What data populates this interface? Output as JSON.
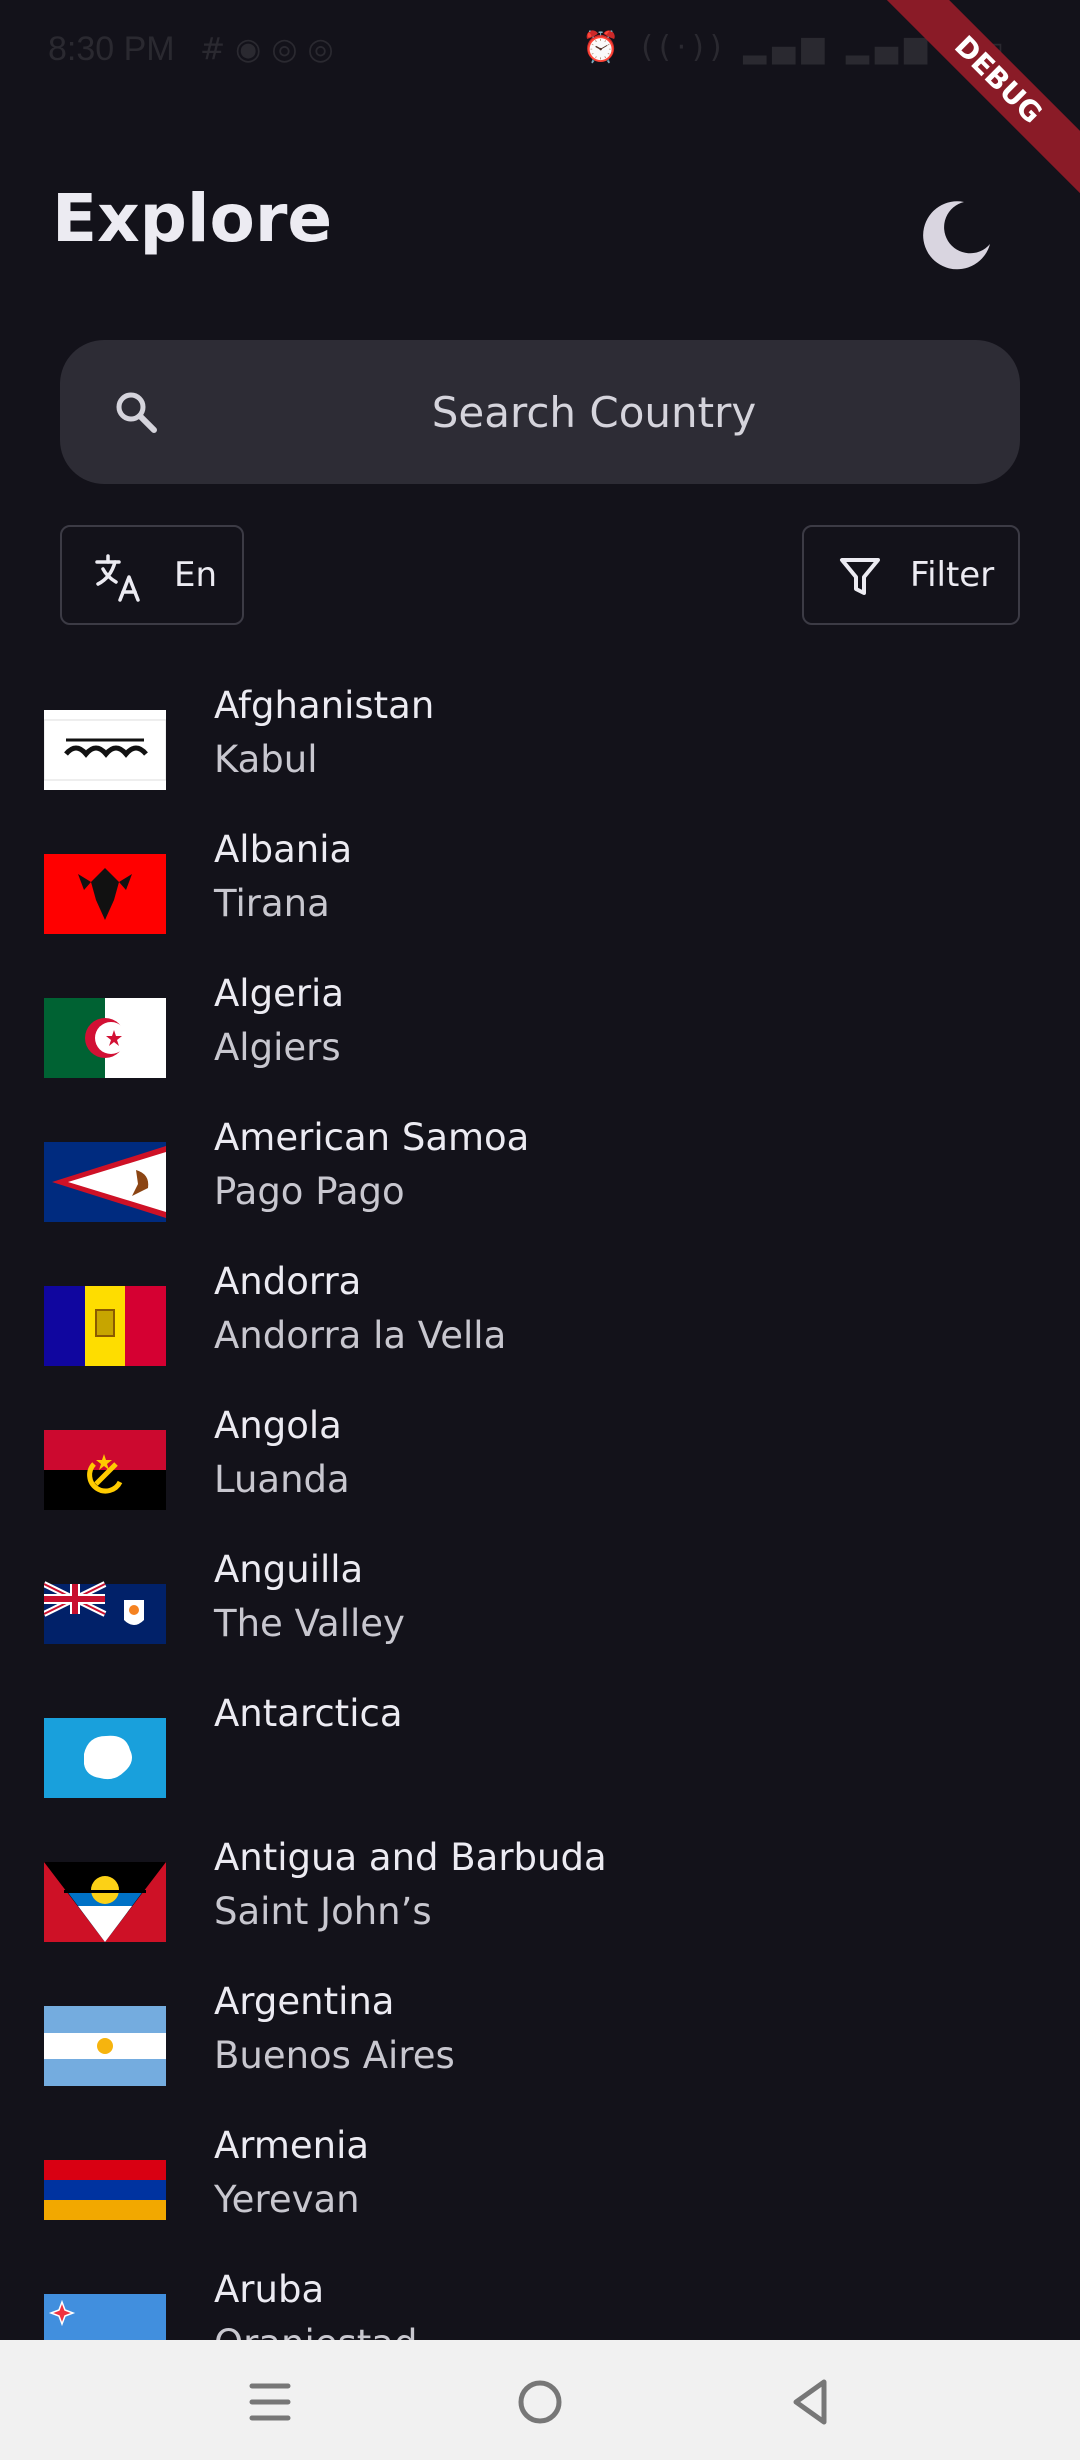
{
  "status": {
    "time": "8:30 PM",
    "debug_label": "DEBUG"
  },
  "header": {
    "title": "Explore"
  },
  "search": {
    "placeholder": "Search Country"
  },
  "controls": {
    "language_label": "En",
    "filter_label": "Filter"
  },
  "countries": [
    {
      "name": "Afghanistan",
      "capital": "Kabul"
    },
    {
      "name": "Albania",
      "capital": "Tirana"
    },
    {
      "name": "Algeria",
      "capital": "Algiers"
    },
    {
      "name": "American Samoa",
      "capital": "Pago Pago"
    },
    {
      "name": "Andorra",
      "capital": "Andorra la Vella"
    },
    {
      "name": "Angola",
      "capital": "Luanda"
    },
    {
      "name": "Anguilla",
      "capital": "The Valley"
    },
    {
      "name": "Antarctica",
      "capital": ""
    },
    {
      "name": "Antigua and Barbuda",
      "capital": "Saint John’s"
    },
    {
      "name": "Argentina",
      "capital": "Buenos Aires"
    },
    {
      "name": "Armenia",
      "capital": "Yerevan"
    },
    {
      "name": "Aruba",
      "capital": "Oranjestad"
    }
  ],
  "icons": {
    "theme_toggle": "moon-icon",
    "search": "search-icon",
    "language": "translate-icon",
    "filter": "filter-icon",
    "nav_menu": "menu-icon",
    "nav_home": "home-circle-icon",
    "nav_back": "back-triangle-icon"
  },
  "colors": {
    "background": "#13121a",
    "search_bg": "#2d2c35",
    "text_primary": "#ecebf2",
    "debug_ribbon": "#8a1b27",
    "nav_bar": "#f1f1f1"
  }
}
